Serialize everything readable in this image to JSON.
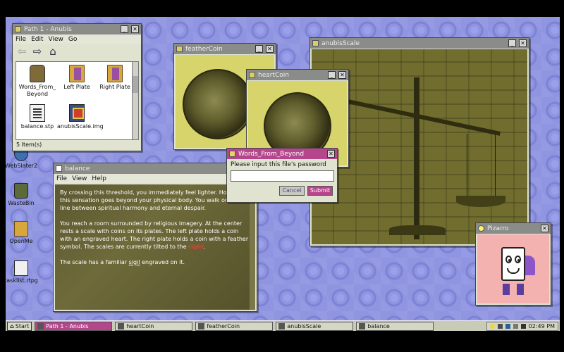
{
  "desktop_icons": [
    {
      "label": "WebSlater2"
    },
    {
      "label": "WasteBin"
    },
    {
      "label": "OpenMe"
    },
    {
      "label": "tasklist.rtpg"
    }
  ],
  "path_window": {
    "title": "Path 1 - Anubis",
    "menu": [
      "File",
      "Edit",
      "View",
      "Go"
    ],
    "files": [
      {
        "label": "Words_From_Beyond",
        "icon": "pot-icon"
      },
      {
        "label": "Left Plate",
        "icon": "folder-icon"
      },
      {
        "label": "Right Plate",
        "icon": "folder-icon"
      },
      {
        "label": "balance.stp",
        "icon": "document-icon"
      },
      {
        "label": "anubisScale.img",
        "icon": "image-icon"
      }
    ],
    "status": "5 Item(s)"
  },
  "feather_window": {
    "title": "featherCoin"
  },
  "heart_window": {
    "title": "heartCoin"
  },
  "scale_window": {
    "title": "anubisScale"
  },
  "password_dialog": {
    "title": "Words_From_Beyond",
    "prompt": "Please input this file's password",
    "input_value": "",
    "cancel_label": "Cancel",
    "submit_label": "Submit"
  },
  "balance_window": {
    "title": "balance",
    "menu": [
      "File",
      "View",
      "Help"
    ],
    "para1": "By crossing this threshold, you immediately feel lighter. However, this sensation goes beyond your physical body. You walk on the line between spiritual harmony and eternal despair.",
    "para2_a": "You reach a room surrounded by religious imagery. At the center rests a scale with coins on its plates. The left plate holds a coin with an engraved heart. The right plate holds a coin with a feather symbol. The scales are currently tilted to the ",
    "para2_red": "right",
    "para2_b": ".",
    "para3_a": "The scale has a familiar ",
    "para3_sigil": "sigil",
    "para3_b": " engraved on it."
  },
  "pizarro_window": {
    "title": "Pizarro"
  },
  "taskbar": {
    "start_label": "Start",
    "tasks": [
      {
        "label": "Path 1 - Anubis"
      },
      {
        "label": "heartCoin"
      },
      {
        "label": "featherCoin"
      },
      {
        "label": "anubisScale"
      },
      {
        "label": "balance"
      }
    ],
    "clock": "02:49 PM"
  },
  "colors": {
    "accent": "#b6468c",
    "desktop": "#8f95e0",
    "image_tint": "#d6d46a"
  }
}
